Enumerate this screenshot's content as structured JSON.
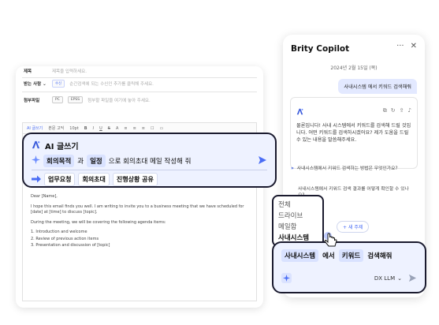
{
  "mail": {
    "subject_label": "제목",
    "subject_placeholder": "제목을 입력하세요.",
    "recipient_label": "받는 사람",
    "recipient_chip": "수신",
    "recipient_placeholder": "순간검색에 되는 수신인 추가를 클릭해 주세요.",
    "attachment_label": "첨부파일",
    "attach_pc": "PC",
    "attach_epss": "EPSS",
    "attach_placeholder": "첨부할 파일을 여기에 놓아 주세요.",
    "toolbar": [
      "AI 글쓰기",
      "본문 고딕",
      "10pt",
      "B",
      "I",
      "U",
      "S",
      "A",
      "≡",
      "≡",
      "≡",
      "☐",
      "▭"
    ],
    "body": {
      "greeting": "Dear [Name],",
      "p1": "I hope this email finds you well. I am writing to invite you to a business meeting that we have scheduled for [date] at [time] to discuss [topic].",
      "p2": "During the meeting, we will be covering the following agenda items:",
      "agenda": [
        "1. Introduction and welcome",
        "2. Review of previous action items",
        "3. Presentation and discussion of [topic]"
      ]
    }
  },
  "ai_writer": {
    "title": "AI 글쓰기",
    "chip1": "회의목적",
    "word1": "과",
    "chip2": "일정",
    "rest": "으로 회의초대 메일 작성해 줘",
    "suggestions": [
      "업무요청",
      "회의초대",
      "진행상황 공유"
    ]
  },
  "copilot": {
    "title": "Brity Copilot",
    "date": "2024년 2월 15일 (목)",
    "user_message": "사내시스템 에서 키워드 검색해줘",
    "answer": "물론입니다! 사내 시스템에서 키워드를 검색해 드릴 것입니다. 어떤 키워드를 검색하시겠어요? 제가 도움을 드릴 수 있는 내용을 말씀해주세요.",
    "follow_ups": [
      "사내시스템에서 키워드 검색하는 방법은 무엇인가요?",
      "사내시스템에서 키워드 검색 결과를 어떻게 확인할 수 있나요?"
    ],
    "dropdown": [
      "전체",
      "드라이브",
      "메일함",
      "사내시스템"
    ],
    "new_topic": "새 주제",
    "input_chip1": "사내시스템",
    "input_word": "에서",
    "input_chip2": "키워드",
    "input_rest": "검색해줘",
    "model": "DX LLM"
  },
  "colors": {
    "accent": "#4a6df5",
    "highlight_bg": "#eef2ff",
    "chip_bg": "#d9e2ff",
    "border_dark": "#1a1a2e"
  }
}
